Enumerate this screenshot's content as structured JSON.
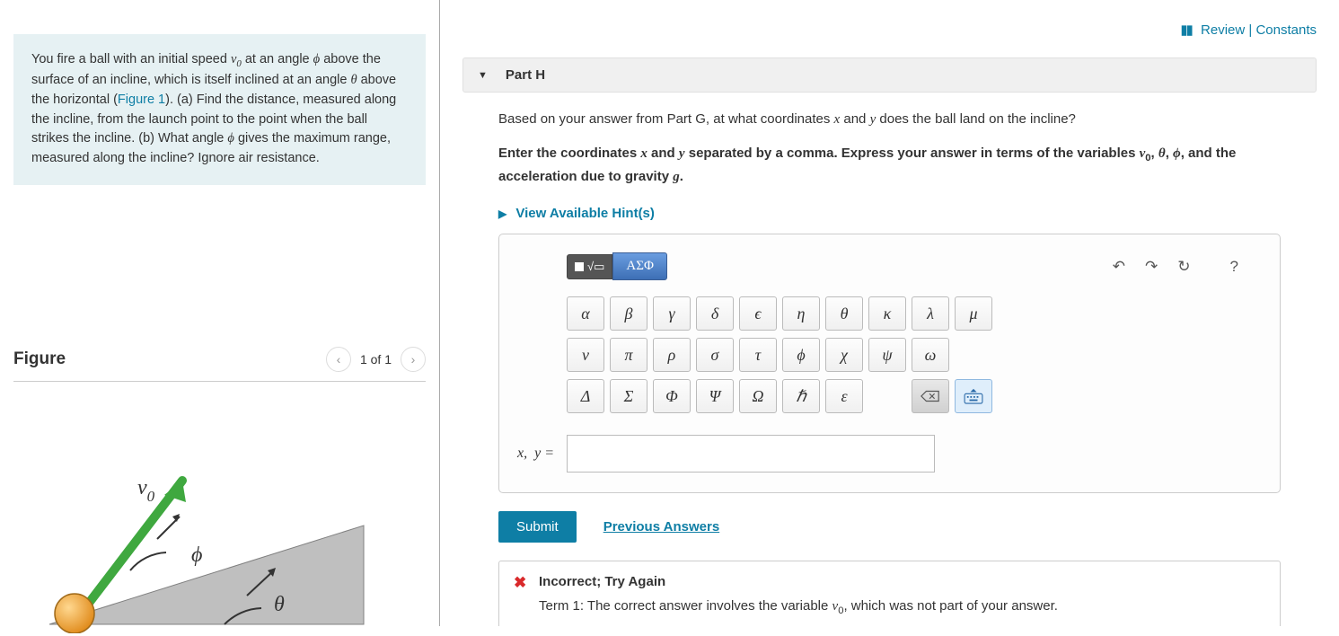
{
  "top_links": {
    "review": "Review",
    "constants": "Constants"
  },
  "problem": {
    "text_before_figlink": "You fire a ball with an initial speed ",
    "v0": "v",
    "v0_sub": "0",
    "text2": " at an angle ",
    "phi": "ϕ",
    "text3": " above the surface of an incline, which is itself inclined at an angle ",
    "theta": "θ",
    "text4": " above the horizontal (",
    "figlink": "Figure 1",
    "text5": "). (a) Find the distance, measured along the incline, from the launch point to the point when the ball strikes the incline. (b) What angle ",
    "phi2": "ϕ",
    "text6": " gives the maximum range, measured along the incline? Ignore air resistance."
  },
  "figure": {
    "title": "Figure",
    "count": "1 of 1",
    "label_v0": "v",
    "label_v0_sub": "0",
    "label_phi": "ϕ",
    "label_theta": "θ"
  },
  "part": {
    "label": "Part H"
  },
  "question": {
    "prefix": "Based on your answer from Part G, at what coordinates ",
    "x": "x",
    "and": " and ",
    "y": "y",
    "suffix": " does the ball land on the incline?"
  },
  "instruction": {
    "prefix": "Enter the coordinates ",
    "x": "x",
    "and": " and ",
    "y": "y",
    "mid": " separated by a comma. Express your answer in terms of the variables ",
    "v0": "v",
    "v0_sub": "0",
    "c1": ", ",
    "theta": "θ",
    "c2": ", ",
    "phi": "ϕ",
    "suffix": ", and the acceleration due to gravity ",
    "g": "g",
    "period": "."
  },
  "hints": "View Available Hint(s)",
  "tabs": {
    "greek": "ΑΣΦ"
  },
  "greek_rows": [
    [
      "α",
      "β",
      "γ",
      "δ",
      "ϵ",
      "η",
      "θ",
      "κ",
      "λ",
      "μ"
    ],
    [
      "ν",
      "π",
      "ρ",
      "σ",
      "τ",
      "ϕ",
      "χ",
      "ψ",
      "ω"
    ],
    [
      "Δ",
      "Σ",
      "Φ",
      "Ψ",
      "Ω",
      "ℏ",
      "ε"
    ]
  ],
  "input_label": "x,  y = ",
  "submit": "Submit",
  "previous_answers": "Previous Answers",
  "feedback": {
    "title": "Incorrect; Try Again",
    "body_prefix": "Term 1: The correct answer involves the variable ",
    "v0": "v",
    "v0_sub": "0",
    "body_suffix": ", which was not part of your answer."
  }
}
